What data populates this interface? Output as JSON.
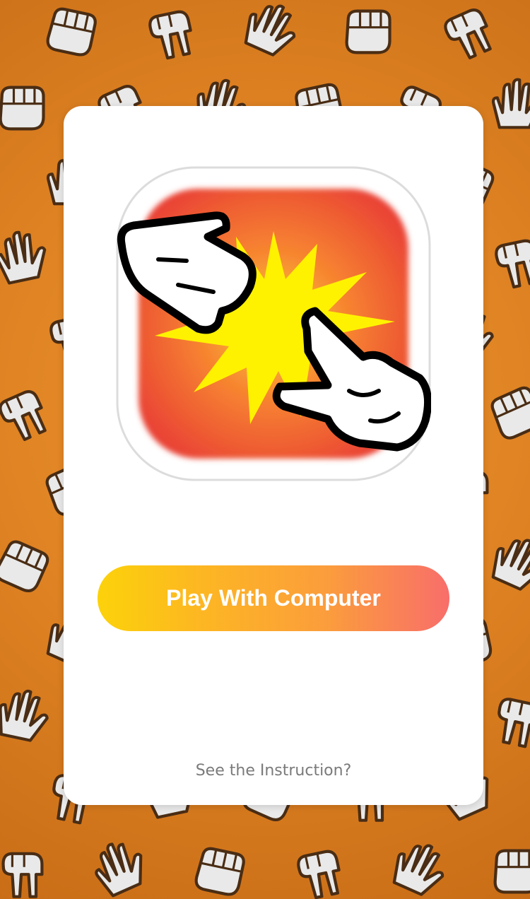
{
  "background": {
    "color": "#e08424",
    "pattern_icons": [
      "paper-hand-icon",
      "rock-fist-icon",
      "scissors-hand-icon"
    ]
  },
  "card": {
    "logo_icon": "rock-paper-scissors-logo-icon",
    "play_button_label": "Play With Computer",
    "instruction_link": "See the Instruction?"
  },
  "colors": {
    "button_gradient_start": "#fcd20a",
    "button_gradient_end": "#f86e6a",
    "logo_red": "#e94235",
    "logo_yellow": "#fff200"
  }
}
